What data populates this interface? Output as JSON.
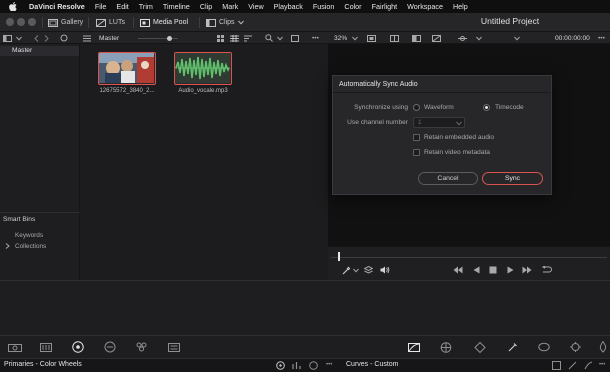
{
  "menubar": {
    "app_name": "DaVinci Resolve",
    "items": [
      "File",
      "Edit",
      "Trim",
      "Timeline",
      "Clip",
      "Mark",
      "View",
      "Playback",
      "Fusion",
      "Color",
      "Fairlight",
      "Workspace",
      "Help"
    ]
  },
  "toolbar": {
    "gallery": "Gallery",
    "luts": "LUTs",
    "media_pool": "Media Pool",
    "clips": "Clips",
    "project_title": "Untitled Project"
  },
  "subbar": {
    "master": "Master",
    "zoom": "32%",
    "timecode": "00:00:00:00"
  },
  "bins": {
    "master": "Master",
    "smart_bins": "Smart Bins",
    "keywords": "Keywords",
    "collections": "Collections"
  },
  "clips": [
    {
      "name": "12675572_3840_2..."
    },
    {
      "name": "Audio_vocale.mp3"
    }
  ],
  "dialog": {
    "title": "Automatically Sync Audio",
    "sync_label": "Synchronize using",
    "waveform": "Waveform",
    "timecode": "Timecode",
    "selected": "Timecode",
    "channel_label": "Use channel number",
    "channel_value": "1",
    "retain_embedded": "Retain embedded audio",
    "retain_metadata": "Retain video metadata",
    "cancel": "Cancel",
    "sync": "Sync"
  },
  "status": {
    "left": "Primaries - Color Wheels",
    "right": "Curves - Custom"
  },
  "colors": {
    "accent": "#d9534f",
    "background": "#1b1b1d",
    "panel": "#1e1e20"
  }
}
